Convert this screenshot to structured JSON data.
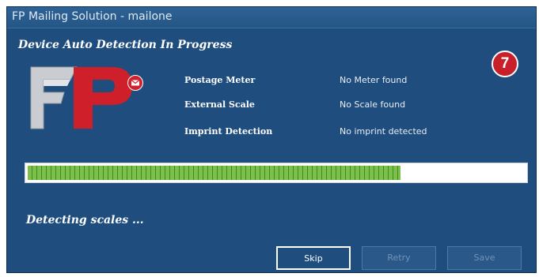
{
  "window": {
    "title": "FP Mailing Solution - mailone"
  },
  "heading": "Device Auto Detection In Progress",
  "badge": "7",
  "devices": [
    {
      "label": "Postage Meter",
      "status": "No Meter found"
    },
    {
      "label": "External Scale",
      "status": "No Scale found"
    },
    {
      "label": "Imprint Detection",
      "status": "No imprint detected"
    }
  ],
  "progress": {
    "percent": 75
  },
  "status_text": "Detecting scales ...",
  "buttons": {
    "skip": "Skip",
    "retry": "Retry",
    "save": "Save"
  },
  "colors": {
    "window_bg": "#1f4d7d",
    "progress_green": "#7cc04b",
    "badge_red": "#c8202a"
  },
  "icons": {
    "logo": "fp-logo",
    "envelope": "envelope-icon"
  }
}
